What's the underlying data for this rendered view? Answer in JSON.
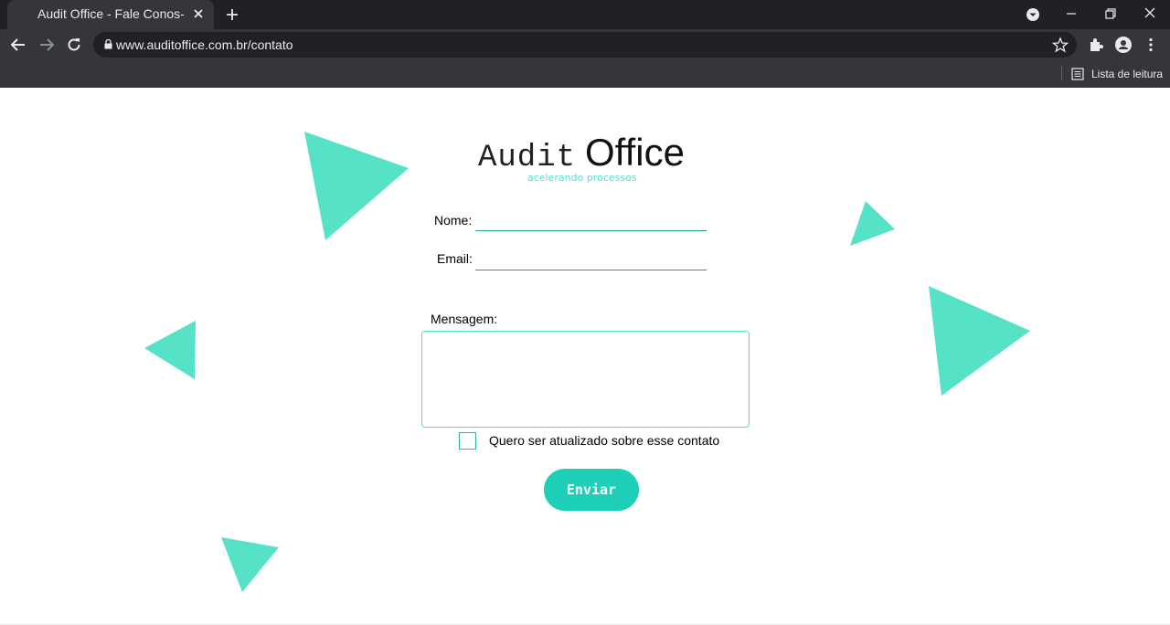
{
  "browser": {
    "tab_title": "Audit Office - Fale Conos-",
    "url": "www.auditoffice.com.br/contato",
    "reading_list_label": "Lista de leitura"
  },
  "logo": {
    "word1": "Audit",
    "word2": "Office",
    "tagline": "acelerando processos"
  },
  "form": {
    "name_label": "Nome:",
    "name_value": "",
    "email_label": "Email:",
    "email_value": "",
    "message_label": "Mensagem:",
    "message_value": "",
    "checkbox_label": "Quero ser atualizado sobre esse contato",
    "checkbox_checked": false,
    "submit_label": "Enviar"
  },
  "colors": {
    "accent": "#1ecfb7",
    "decoration": "#56e2c6",
    "chrome_dark": "#202124",
    "chrome_mid": "#35363a"
  }
}
